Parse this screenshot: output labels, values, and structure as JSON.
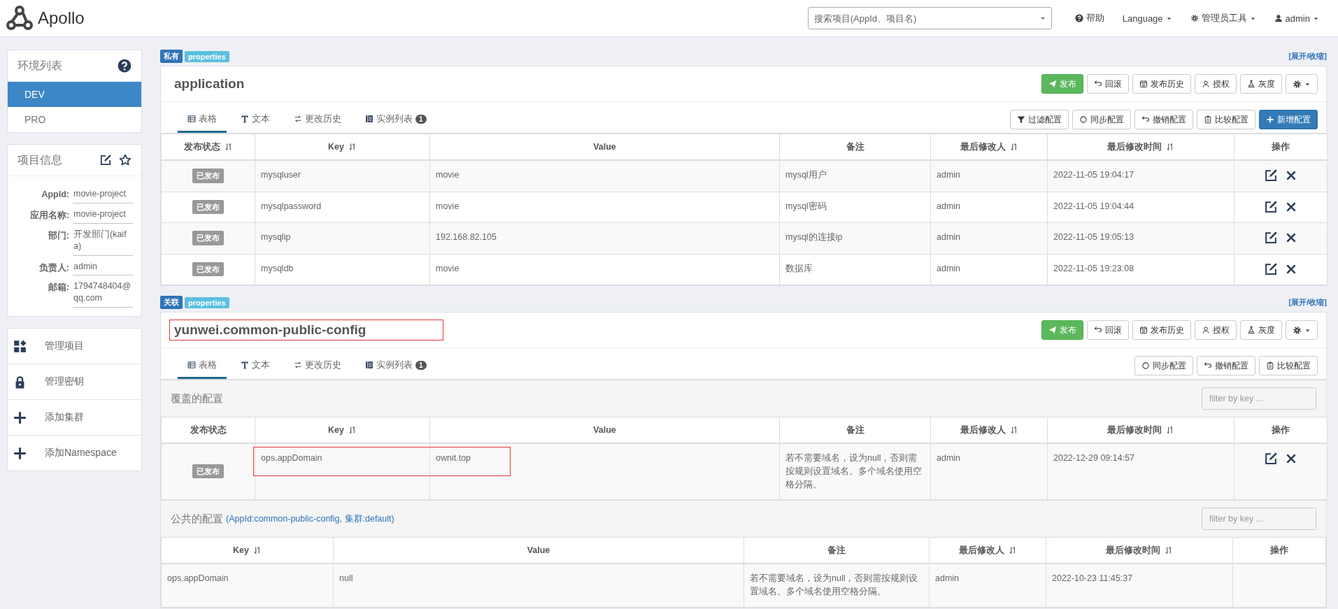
{
  "header": {
    "logo_text": "Apollo",
    "search": {
      "placeholder": "搜索项目(AppId、项目名)"
    },
    "nav": [
      {
        "kind": "help",
        "label": "帮助",
        "dropdown": false
      },
      {
        "kind": "language",
        "label": "Language",
        "dropdown": true
      },
      {
        "kind": "tools",
        "label": "管理员工具",
        "dropdown": true
      },
      {
        "kind": "user",
        "label": "admin",
        "dropdown": true
      }
    ]
  },
  "sidebar": {
    "env_title": "环境列表",
    "envs": [
      {
        "label": "DEV",
        "selected": true
      },
      {
        "label": "PRO",
        "selected": false
      }
    ],
    "info_title": "项目信息",
    "info": [
      {
        "label": "AppId:",
        "value": "movie-project"
      },
      {
        "label": "应用名称:",
        "value": "movie-project"
      },
      {
        "label": "部门:",
        "value": "开发部门(kaifa)"
      },
      {
        "label": "负责人:",
        "value": "admin"
      },
      {
        "label": "邮箱:",
        "value": "1794748404@qq.com"
      }
    ],
    "actions": [
      {
        "kind": "manage-project",
        "label": "管理项目"
      },
      {
        "kind": "manage-secret",
        "label": "管理密钥"
      },
      {
        "kind": "add-cluster",
        "label": "添加集群"
      },
      {
        "kind": "add-namespace",
        "label": "添加Namespace"
      }
    ]
  },
  "namespaces": [
    {
      "tags": [
        {
          "kind": "scope",
          "label": "私有"
        },
        {
          "kind": "format",
          "label": "properties"
        }
      ],
      "toggle": "[展开/收缩]",
      "title": "application",
      "annotated": false,
      "buttons": [
        {
          "kind": "publish",
          "label": "发布"
        },
        {
          "kind": "rollback",
          "label": "回滚"
        },
        {
          "kind": "history",
          "label": "发布历史"
        },
        {
          "kind": "auth",
          "label": "授权"
        },
        {
          "kind": "gray",
          "label": "灰度"
        },
        {
          "kind": "settings"
        }
      ],
      "tabs": [
        {
          "kind": "table",
          "label": "表格",
          "selected": true
        },
        {
          "kind": "text",
          "label": "文本",
          "selected": false
        },
        {
          "kind": "history",
          "label": "更改历史",
          "selected": false
        },
        {
          "kind": "instances",
          "label": "实例列表",
          "badge": "1",
          "selected": false
        }
      ],
      "tools": [
        {
          "kind": "filter",
          "label": "过滤配置"
        },
        {
          "kind": "sync",
          "label": "同步配置"
        },
        {
          "kind": "revert",
          "label": "撤销配置"
        },
        {
          "kind": "compare",
          "label": "比较配置"
        },
        {
          "kind": "add",
          "label": "新增配置"
        }
      ],
      "sections": [
        {
          "columns": [
            {
              "kind": "status",
              "label": "发布状态",
              "sortable": true
            },
            {
              "label": "Key",
              "sortable": true
            },
            {
              "label": "Value",
              "sortable": false
            },
            {
              "label": "备注",
              "sortable": false
            },
            {
              "label": "最后修改人",
              "sortable": true
            },
            {
              "label": "最后修改时间",
              "sortable": true
            },
            {
              "label": "操作",
              "sortable": false
            }
          ],
          "rows": [
            {
              "cells": [
                "已发布",
                "mysqluser",
                "movie",
                "mysql用户",
                "admin",
                "2022-11-05 19:04:17"
              ],
              "editable": true,
              "annotated": false
            },
            {
              "cells": [
                "已发布",
                "mysqlpassword",
                "movie",
                "mysql密码",
                "admin",
                "2022-11-05 19:04:44"
              ],
              "editable": true,
              "annotated": false
            },
            {
              "cells": [
                "已发布",
                "mysqlip",
                "192.168.82.105",
                "mysql的连接ip",
                "admin",
                "2022-11-05 19:05:13"
              ],
              "editable": true,
              "annotated": false
            },
            {
              "cells": [
                "已发布",
                "mysqldb",
                "movie",
                "数据库",
                "admin",
                "2022-11-05 19:23:08"
              ],
              "editable": true,
              "annotated": false
            }
          ]
        }
      ]
    },
    {
      "tags": [
        {
          "kind": "scope",
          "label": "关联"
        },
        {
          "kind": "format",
          "label": "properties"
        }
      ],
      "toggle": "[展开/收缩]",
      "title": "yunwei.common-public-config",
      "annotated": true,
      "buttons": [
        {
          "kind": "publish",
          "label": "发布"
        },
        {
          "kind": "rollback",
          "label": "回滚"
        },
        {
          "kind": "history",
          "label": "发布历史"
        },
        {
          "kind": "auth",
          "label": "授权"
        },
        {
          "kind": "gray",
          "label": "灰度"
        },
        {
          "kind": "settings"
        }
      ],
      "tabs": [
        {
          "kind": "table",
          "label": "表格",
          "selected": true
        },
        {
          "kind": "text",
          "label": "文本",
          "selected": false
        },
        {
          "kind": "history",
          "label": "更改历史",
          "selected": false
        },
        {
          "kind": "instances",
          "label": "实例列表",
          "badge": "1",
          "selected": false
        }
      ],
      "tools": [
        {
          "kind": "sync",
          "label": "同步配置"
        },
        {
          "kind": "revert",
          "label": "撤销配置"
        },
        {
          "kind": "compare",
          "label": "比较配置"
        }
      ],
      "sections": [
        {
          "title": "覆盖的配置",
          "filter_placeholder": "filter by key ...",
          "columns": [
            {
              "kind": "status",
              "label": "发布状态",
              "sortable": false
            },
            {
              "label": "Key",
              "sortable": true
            },
            {
              "label": "Value",
              "sortable": false
            },
            {
              "label": "备注",
              "sortable": false
            },
            {
              "label": "最后修改人",
              "sortable": true
            },
            {
              "label": "最后修改时间",
              "sortable": true
            },
            {
              "label": "操作",
              "sortable": false
            }
          ],
          "rows": [
            {
              "cells": [
                "已发布",
                "ops.appDomain",
                "ownit.top",
                "若不需要域名，设为null，否则需按规则设置域名。多个域名使用空格分隔。",
                "admin",
                "2022-12-29 09:14:57"
              ],
              "editable": true,
              "annotated": true
            }
          ]
        },
        {
          "title": "公共的配置",
          "subtitle": "(AppId:common-public-config, 集群:default)",
          "filter_placeholder": "filter by key ...",
          "columns": [
            {
              "label": "Key",
              "sortable": true
            },
            {
              "label": "Value",
              "sortable": false
            },
            {
              "label": "备注",
              "sortable": false
            },
            {
              "label": "最后修改人",
              "sortable": true
            },
            {
              "label": "最后修改时间",
              "sortable": true
            },
            {
              "label": "操作",
              "sortable": false
            }
          ],
          "rows": [
            {
              "cells": [
                "ops.appDomain",
                "null",
                "若不需要域名，设为null，否则需按规则设置域名。多个域名使用空格分隔。",
                "admin",
                "2022-10-23 11:45:37"
              ],
              "editable": false,
              "annotated": false
            }
          ]
        }
      ]
    }
  ]
}
